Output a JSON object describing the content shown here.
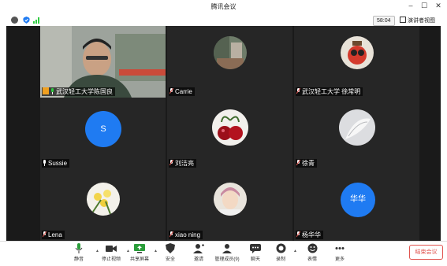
{
  "window": {
    "title": "腾讯会议"
  },
  "status": {
    "timer": "58:04",
    "speaker_view_label": "演讲者视图"
  },
  "participants": [
    {
      "name": "武汉轻工大学陈国良",
      "avatar": "camera-video",
      "speaking": true
    },
    {
      "name": "Carrie",
      "avatar": "photo-room",
      "muted": true
    },
    {
      "name": "武汉轻工大学 徐常明",
      "avatar": "photo-red-toy",
      "muted": true
    },
    {
      "name": "Sussie",
      "avatar": "initial",
      "initial": "S",
      "muted": false
    },
    {
      "name": "刘洁亮",
      "avatar": "photo-cherries",
      "muted": true
    },
    {
      "name": "徐青",
      "avatar": "photo-white-flower",
      "muted": true
    },
    {
      "name": "Lena",
      "avatar": "photo-yellow-flowers",
      "muted": true
    },
    {
      "name": "xiao ning",
      "avatar": "photo-girl",
      "muted": true
    },
    {
      "name": "杨华华",
      "avatar": "initial",
      "initial": "华华",
      "muted": true
    }
  ],
  "toolbar": {
    "items": [
      {
        "label": "静音",
        "icon": "microphone-icon"
      },
      {
        "label": "停止视频",
        "icon": "video-camera-icon"
      },
      {
        "label": "共享屏幕",
        "icon": "share-screen-icon"
      },
      {
        "label": "安全",
        "icon": "shield-icon"
      },
      {
        "label": "邀请",
        "icon": "invite-user-icon"
      },
      {
        "label": "管理成员(9)",
        "icon": "members-icon"
      },
      {
        "label": "聊天",
        "icon": "chat-icon"
      },
      {
        "label": "录制",
        "icon": "record-icon"
      },
      {
        "label": "表情",
        "icon": "emoji-icon"
      },
      {
        "label": "更多",
        "icon": "more-icon"
      }
    ],
    "end_label": "结束会议"
  },
  "colors": {
    "accent": "#1f7bf2",
    "danger": "#e0534e",
    "speaking": "#2ecc40",
    "stage": "#1a1a1a"
  }
}
